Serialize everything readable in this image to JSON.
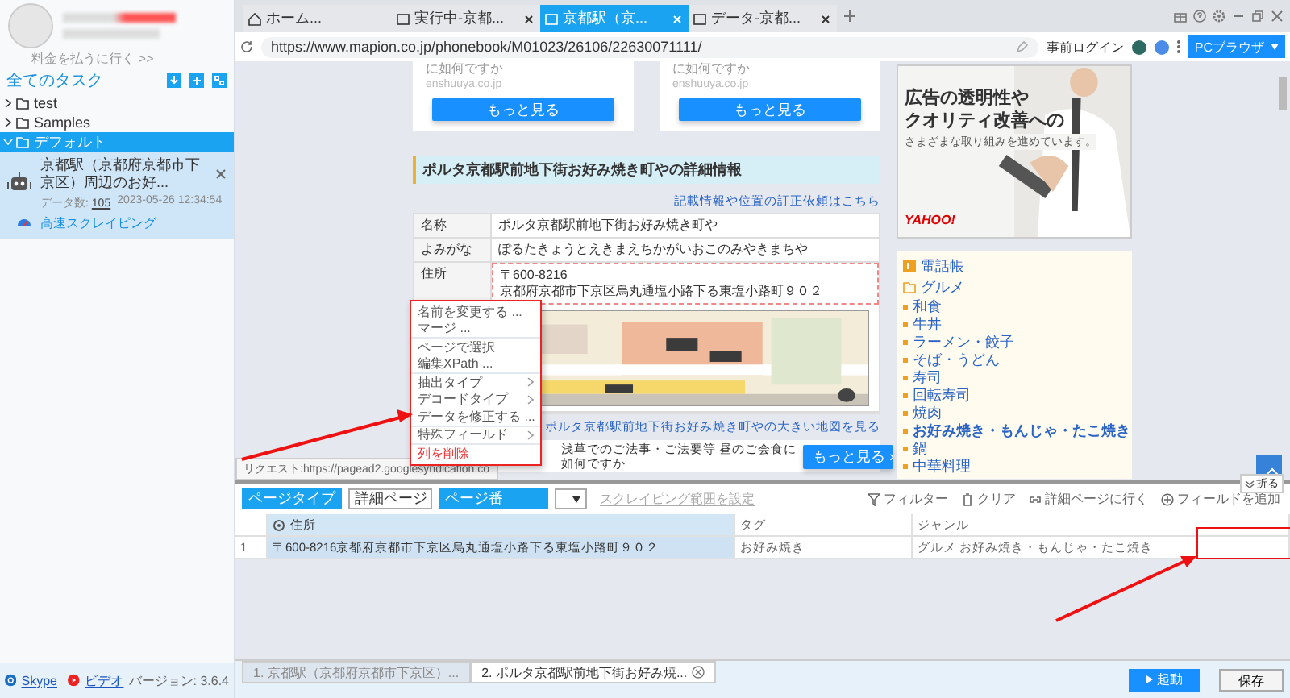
{
  "sidebar": {
    "upgrade_link": "料金を払うに行く >>",
    "header": "全てのタスク",
    "folders": [
      {
        "name": "test",
        "expanded": false,
        "selected": false
      },
      {
        "name": "Samples",
        "expanded": false,
        "selected": false
      },
      {
        "name": "デフォルト",
        "expanded": true,
        "selected": true
      }
    ],
    "task": {
      "title": "京都駅（京都府京都市下京区）周辺のお好...",
      "count_label": "データ数:",
      "count": "105",
      "time": "2023-05-26 12:34:54",
      "mode": "高速スクレイピング"
    },
    "footer": {
      "links": [
        "Skype",
        "ビデオ"
      ],
      "version": "バージョン: 3.6.4"
    }
  },
  "browser": {
    "tabs": [
      {
        "label": "ホーム...",
        "kind": "home",
        "selected": false
      },
      {
        "label": "実行中-京都...",
        "kind": "page",
        "selected": false
      },
      {
        "label": "京都駅（京...",
        "kind": "page",
        "selected": true
      },
      {
        "label": "データ-京都...",
        "kind": "page",
        "selected": false
      }
    ],
    "url": "https://www.mapion.co.jp/phonebook/M01023/26106/22630071111/",
    "login": "事前ログイン",
    "mode_button": "PCブラウザ"
  },
  "page": {
    "cards": [
      {
        "text": "に如何ですか",
        "domain": "enshuuya.co.jp",
        "button": "もっと見る"
      },
      {
        "text": "に如何ですか",
        "domain": "enshuuya.co.jp",
        "button": "もっと見る"
      }
    ],
    "section_title": "ポルタ京都駅前地下街お好み焼き町やの詳細情報",
    "correction_link": "記載情報や位置の訂正依頼はこちら",
    "details": [
      {
        "label": "名称",
        "lines": [
          "ポルタ京都駅前地下街お好み焼き町や"
        ]
      },
      {
        "label": "よみがな",
        "lines": [
          "ぽるたきょうとえきまえちかがいおこのみやきまちや"
        ]
      },
      {
        "label": "住所",
        "lines": [
          "〒600-8216",
          "京都府京都市下京区烏丸通塩小路下る東塩小路町９０２"
        ]
      }
    ],
    "map_link": "ポルタ京都駅前地下街お好み焼き町やの大きい地図を見る",
    "ad": {
      "line1": "浅草でのご法事・ご法要等 昼のご会食に",
      "line2": "如何ですか",
      "button": "もっと見る ›"
    },
    "banner": {
      "headline": [
        "広告の透明性や",
        "クオリティ改善への"
      ],
      "sub": "さまざまな取り組みを進めています。",
      "logo": "YAHOO!"
    },
    "directory": {
      "title": "電話帳",
      "category": "グルメ",
      "items": [
        {
          "label": "和食",
          "selected": false
        },
        {
          "label": "牛丼",
          "selected": false
        },
        {
          "label": "ラーメン・餃子",
          "selected": false
        },
        {
          "label": "そば・うどん",
          "selected": false
        },
        {
          "label": "寿司",
          "selected": false
        },
        {
          "label": "回転寿司",
          "selected": false
        },
        {
          "label": "焼肉",
          "selected": false
        },
        {
          "label": "お好み焼き・もんじゃ・たこ焼き",
          "selected": true
        },
        {
          "label": "鍋",
          "selected": false
        },
        {
          "label": "中華料理",
          "selected": false
        }
      ]
    },
    "status_url": "リクエスト:https://pagead2.googlesyndication.co"
  },
  "context_menu": [
    [
      {
        "label": "名前を変更する ...",
        "kind": "action"
      },
      {
        "label": "マージ ...",
        "kind": "action"
      }
    ],
    [
      {
        "label": "ページで選択",
        "kind": "action"
      },
      {
        "label": "編集XPath ...",
        "kind": "action"
      }
    ],
    [
      {
        "label": "抽出タイプ",
        "kind": "submenu"
      },
      {
        "label": "デコードタイプ",
        "kind": "submenu"
      },
      {
        "label": "データを修正する ...",
        "kind": "action"
      }
    ],
    [
      {
        "label": "特殊フィールド",
        "kind": "submenu"
      }
    ],
    [
      {
        "label": "列を削除",
        "kind": "danger"
      }
    ]
  ],
  "panel": {
    "page_type_label": "ページタイプ",
    "page_type": "詳細ページ",
    "page_no_label": "ページ番",
    "range_link": "スクレイピング範囲を設定",
    "tools": [
      {
        "label": "フィルター",
        "kind": "filter"
      },
      {
        "label": "クリア",
        "kind": "clear"
      },
      {
        "label": "詳細ページに行く",
        "kind": "link"
      },
      {
        "label": "フィールドを追加",
        "kind": "add"
      }
    ],
    "fold": "折る",
    "columns": [
      {
        "label": "住所",
        "selected": true
      },
      {
        "label": "タグ",
        "selected": false
      },
      {
        "label": "ジャンル",
        "selected": false
      }
    ],
    "rows": [
      {
        "index": "1",
        "cells": [
          "〒600-8216京都府京都市下京区烏丸通塩小路下る東塩小路町９０２",
          "お好み焼き",
          "グルメ お好み焼き・もんじゃ・たこ焼き"
        ]
      }
    ]
  },
  "result_tabs": [
    {
      "label": "1. 京都駅（京都府京都市下京区）...",
      "selected": false
    },
    {
      "label": "2. ポルタ京都駅前地下街お好み焼...",
      "selected": true
    }
  ],
  "actions": {
    "start": "起動",
    "save": "保存"
  }
}
